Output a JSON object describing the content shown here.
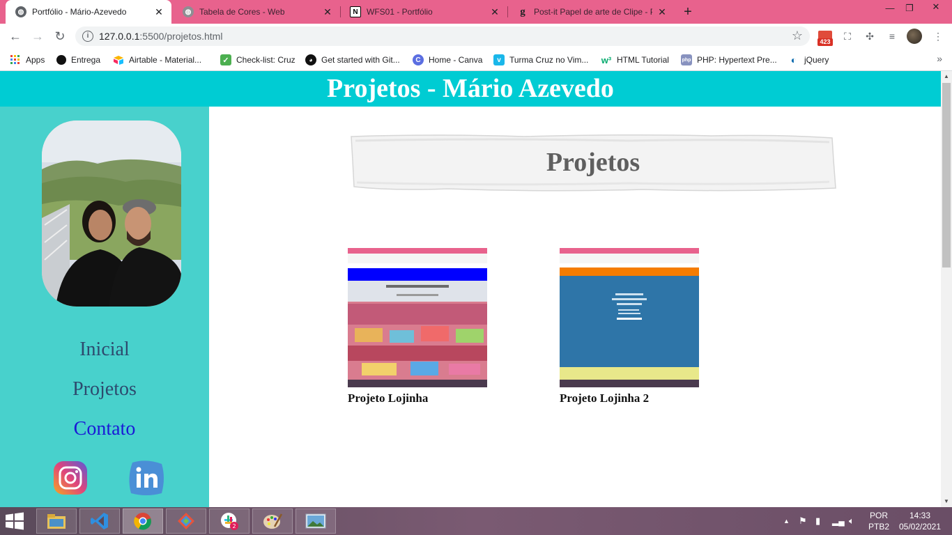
{
  "browser": {
    "tabs": [
      {
        "title": "Portfólio - Mário-Azevedo",
        "active": true,
        "icon": "globe-icon"
      },
      {
        "title": "Tabela de Cores - Web",
        "active": false,
        "icon": "globe-icon"
      },
      {
        "title": "WFS01 - Portfólio",
        "active": false,
        "icon": "notion-icon"
      },
      {
        "title": "Post-it Papel de arte de Clipe - P",
        "active": false,
        "icon": "g-icon"
      }
    ],
    "url_host": "127.0.0.1",
    "url_rest": ":5500/projetos.html",
    "gmail_count": "423",
    "bookmarks": [
      {
        "label": "Apps",
        "icon": "apps-grid-icon"
      },
      {
        "label": "Entrega",
        "icon": "circle-icon"
      },
      {
        "label": "Airtable - Material...",
        "icon": "airtable-icon"
      },
      {
        "label": "Check-list: Cruz",
        "icon": "checkbox-icon"
      },
      {
        "label": "Get started with Git...",
        "icon": "github-icon"
      },
      {
        "label": "Home - Canva",
        "icon": "canva-icon"
      },
      {
        "label": "Turma Cruz no Vim...",
        "icon": "vimeo-icon"
      },
      {
        "label": "HTML Tutorial",
        "icon": "w3schools-icon"
      },
      {
        "label": "PHP: Hypertext Pre...",
        "icon": "php-icon"
      },
      {
        "label": "jQuery",
        "icon": "jquery-icon"
      }
    ]
  },
  "page": {
    "header_title": "Projetos - Mário Azevedo",
    "nav": [
      {
        "label": "Inicial",
        "active": false
      },
      {
        "label": "Projetos",
        "active": false
      },
      {
        "label": "Contato",
        "active": true
      }
    ],
    "section_title": "Projetos",
    "projects": [
      {
        "caption": "Projeto Lojinha"
      },
      {
        "caption": "Projeto Lojinha 2"
      }
    ]
  },
  "taskbar": {
    "lang_top": "POR",
    "lang_bottom": "PTB2",
    "time": "14:33",
    "date": "05/02/2021"
  },
  "colors": {
    "tab_strip": "#e8628d",
    "header": "#00ccd3",
    "sidebar": "#48d1cc",
    "active_link": "#1a1ad6"
  }
}
